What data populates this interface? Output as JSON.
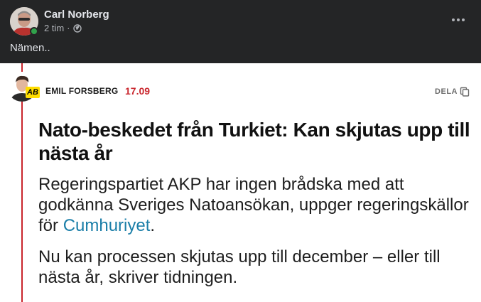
{
  "post": {
    "author": "Carl Norberg",
    "time": "2 tim",
    "separator": "·",
    "text": "Nämen..",
    "privacy_icon": "globe-icon",
    "menu_icon": "more-dots-icon"
  },
  "article": {
    "reporter": "EMIL FORSBERG",
    "badge": "AB",
    "timestamp": "17.09",
    "share_label": "DELA",
    "share_icon": "copy-icon",
    "headline": "Nato-beskedet från Turkiet: Kan skjutas upp till nästa år",
    "lead_prefix": "Regeringspartiet AKP har ingen brådska med att godkänna Sveriges Natoansökan, uppger regeringskällor för ",
    "lead_link": "Cumhuriyet",
    "lead_suffix": ".",
    "body": "Nu kan processen skjutas upp till december – eller till nästa år, skriver tidningen."
  },
  "colors": {
    "background": "#242526",
    "accent_red": "#c9252c",
    "link_blue": "#1a7ea8",
    "online_green": "#31a24c",
    "badge_yellow": "#ffdd00"
  }
}
